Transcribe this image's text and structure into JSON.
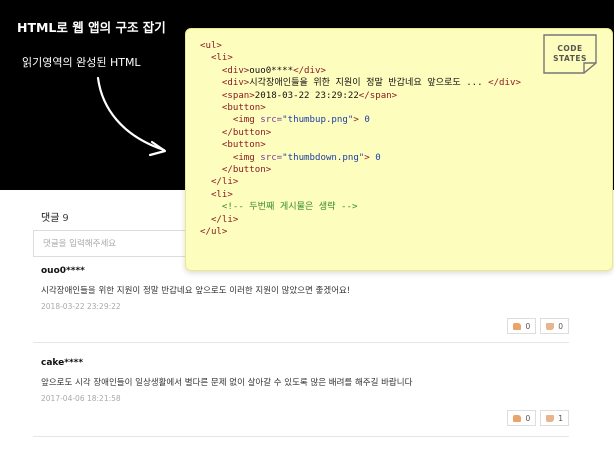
{
  "slide": {
    "title": "HTML로 웹 앱의 구조 잡기",
    "subtitle": "읽기영역의 완성된 HTML"
  },
  "comments": {
    "count_label": "댓글",
    "count": "9",
    "input_placeholder": "댓글을 입력해주세요",
    "items": [
      {
        "author": "ouo0****",
        "body": "시각장애인들을 위한 지원이 정말 반갑네요 앞으로도 이러한 지원이 많았으면 좋겠어요!",
        "date": "2018-03-22 23:29:22",
        "up": "0",
        "down": "0"
      },
      {
        "author": "cake****",
        "body": "앞으로도 시각 장애인들이 일상생활에서 별다른 문제 없이 살아갈 수 있도록 많은 배려를 해주길 바랍니다",
        "date": "2017-04-06 18:21:58",
        "up": "0",
        "down": "1"
      }
    ]
  },
  "code": {
    "ul_open": "<ul>",
    "li_open": "<li>",
    "div_open": "<div>",
    "div_close": "</div>",
    "author": "ouo0****",
    "body_text": "시각장애인들을 위한 지원이 정말 반갑네요 앞으로도 ...",
    "span_open": "<span>",
    "span_close": "</span>",
    "date": "2018-03-22 23:29:22",
    "button_open": "<button>",
    "button_close": "</button>",
    "img_open": "<img",
    "src_attr": "src=",
    "thumbup_src": "\"thumbup.png\"",
    "thumbdown_src": "\"thumbdown.png\"",
    "tag_end": ">",
    "up_count": "0",
    "down_count": "0",
    "li_close": "</li>",
    "comment": "<!-- 두번째 게시물은 생략 -->",
    "ul_close": "</ul>"
  },
  "badge": {
    "line1": "CODE",
    "line2": "STATES"
  },
  "colors": {
    "code_bg": "#fdfdbd",
    "tag": "#8b1c24",
    "string": "#1d3ea8",
    "comment": "#3a8a2d",
    "panel_bg": "#000000"
  }
}
